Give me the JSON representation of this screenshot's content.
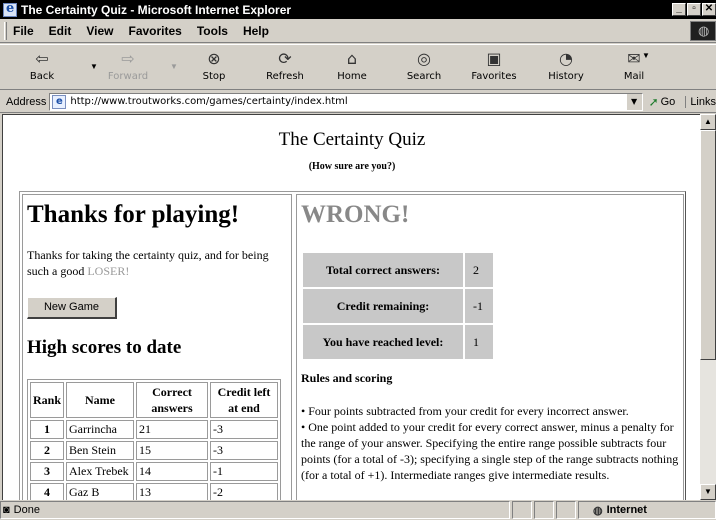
{
  "window": {
    "title": "The Certainty Quiz - Microsoft Internet Explorer",
    "controls": [
      "_",
      "▫",
      "✕"
    ]
  },
  "menu": [
    "File",
    "Edit",
    "View",
    "Favorites",
    "Tools",
    "Help"
  ],
  "toolbar": {
    "back": "Back",
    "forward": "Forward",
    "stop": "Stop",
    "refresh": "Refresh",
    "home": "Home",
    "search": "Search",
    "favorites": "Favorites",
    "history": "History",
    "mail": "Mail"
  },
  "address": {
    "label": "Address",
    "url": "http://www.troutworks.com/games/certainty/index.html",
    "go": "Go",
    "links": "Links"
  },
  "page": {
    "title": "The Certainty Quiz",
    "subtitle": "(How sure are you?)",
    "thanks_heading": "Thanks for playing!",
    "thanks_text": "Thanks for taking the certainty quiz, and for being such a good",
    "thanks_loser": "LOSER!",
    "new_game": "New Game",
    "high_scores_heading": "High scores to date",
    "high_scores": {
      "headers": [
        "Rank",
        "Name",
        "Correct answers",
        "Credit left at end"
      ],
      "rows": [
        {
          "rank": "1",
          "name": "Garrincha",
          "correct": "21",
          "credit": "-3"
        },
        {
          "rank": "2",
          "name": "Ben Stein",
          "correct": "15",
          "credit": "-3"
        },
        {
          "rank": "3",
          "name": "Alex Trebek",
          "correct": "14",
          "credit": "-1"
        },
        {
          "rank": "4",
          "name": "Gaz B",
          "correct": "13",
          "credit": "-2"
        }
      ]
    },
    "result": "WRONG!",
    "stats": [
      {
        "label": "Total correct answers:",
        "value": "2"
      },
      {
        "label": "Credit remaining:",
        "value": "-1"
      },
      {
        "label": "You have reached level:",
        "value": "1"
      }
    ],
    "rules_heading": "Rules and scoring",
    "rules": [
      "• Four points subtracted from your credit for every incorrect answer.",
      "• One point added to your credit for every correct answer, minus a penalty for the range of your answer. Specifying the entire range possible subtracts four points (for a total of -3); specifying a single step of the range subtracts nothing (for a total of +1). Intermediate ranges give intermediate results."
    ]
  },
  "status": {
    "text": "Done",
    "zone": "Internet"
  }
}
